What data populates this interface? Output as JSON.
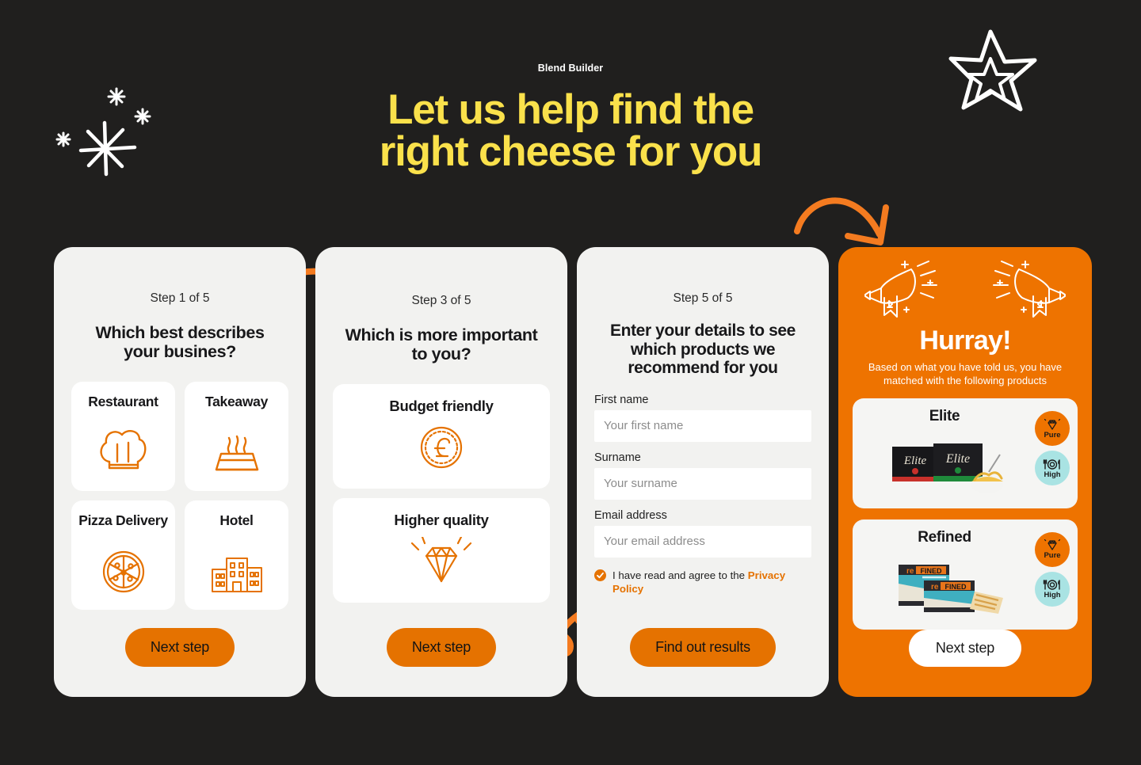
{
  "header": {
    "brand": "Blend Builder",
    "headline_line1": "Let us help find the",
    "headline_line2": "right cheese for you",
    "headline_color": "#FAE14B",
    "background_color": "#201F1E"
  },
  "theme": {
    "accent_orange": "#EE7300",
    "button_orange": "#E57200",
    "card_grey": "#F2F2F0",
    "badge_blue": "#A9E3E3",
    "text_dark": "#18181A"
  },
  "decorations": [
    {
      "name": "sparkle-burst",
      "color": "#FFFFFF"
    },
    {
      "name": "double-star",
      "color": "#FFFFFF"
    },
    {
      "name": "curved-arrow-right",
      "color": "#F47B20"
    },
    {
      "name": "curved-arrow-down",
      "color": "#F47B20"
    },
    {
      "name": "squiggle-arrow-up",
      "color": "#F47B20"
    }
  ],
  "cards": [
    {
      "step": "Step 1 of 5",
      "question": "Which best describes your busines?",
      "options": [
        {
          "label": "Restaurant",
          "icon": "chef-hat-icon"
        },
        {
          "label": "Takeaway",
          "icon": "takeaway-box-icon"
        },
        {
          "label": "Pizza Delivery",
          "icon": "pizza-icon"
        },
        {
          "label": "Hotel",
          "icon": "hotel-building-icon"
        }
      ],
      "button": "Next step"
    },
    {
      "step": "Step 3 of 5",
      "question": "Which is more important to you?",
      "options": [
        {
          "label": "Budget friendly",
          "icon": "pound-coin-icon"
        },
        {
          "label": "Higher quality",
          "icon": "diamond-icon"
        }
      ],
      "button": "Next step"
    }
  ],
  "form_card": {
    "step": "Step 5 of 5",
    "question": "Enter your details to see which products we recommend for you",
    "fields": [
      {
        "label": "First name",
        "placeholder": "Your first name",
        "value": ""
      },
      {
        "label": "Surname",
        "placeholder": "Your surname",
        "value": ""
      },
      {
        "label": "Email address",
        "placeholder": "Your email address",
        "value": ""
      }
    ],
    "consent_text": "I have read and agree to the ",
    "consent_link": "Privacy Policy",
    "consent_checked": true,
    "button": "Find out results"
  },
  "results_card": {
    "title": "Hurray!",
    "subtitle": "Based on what you have told us, you have matched with the following products",
    "horn_icon": "megaphone-horn-icon",
    "products": [
      {
        "name": "Elite",
        "image": "elite-cheese-boxes-with-pasta-bowl",
        "badges": [
          {
            "label": "Pure",
            "icon": "diamond-icon",
            "color": "#EE7300"
          },
          {
            "label": "High",
            "icon": "plate-cutlery-icon",
            "color": "#A9E3E3"
          }
        ]
      },
      {
        "name": "Refined",
        "image": "refined-cheese-packets-with-sandwich",
        "badges": [
          {
            "label": "Pure",
            "icon": "diamond-icon",
            "color": "#EE7300"
          },
          {
            "label": "High",
            "icon": "plate-cutlery-icon",
            "color": "#A9E3E3"
          }
        ]
      }
    ],
    "button": "Next step"
  }
}
